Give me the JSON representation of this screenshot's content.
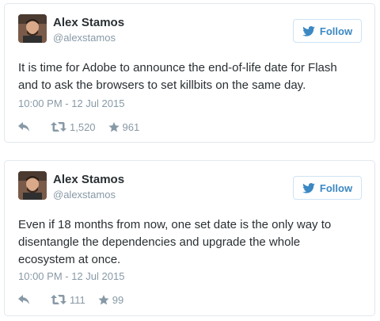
{
  "colors": {
    "follow_blue": "#3b88c3",
    "meta_gray": "#8899a6",
    "text_dark": "#292f33",
    "border": "#e1e8ed"
  },
  "icons": {
    "follow": "twitter-bird-icon",
    "reply": "reply-arrow-icon",
    "retweet": "retweet-icon",
    "favorite": "star-icon"
  },
  "tweets": [
    {
      "name": "Alex Stamos",
      "handle": "@alexstamos",
      "follow_label": "Follow",
      "text": "It is time for Adobe to announce the end-of-life date for Flash\nand to ask the browsers to set killbits on the same day.",
      "timestamp": "10:00 PM - 12 Jul 2015",
      "retweets": "1,520",
      "favorites": "961"
    },
    {
      "name": "Alex Stamos",
      "handle": "@alexstamos",
      "follow_label": "Follow",
      "text": "Even if 18 months from now, one set date is the only way to\ndisentangle the dependencies and upgrade the whole\necosystem at once.",
      "timestamp": "10:00 PM - 12 Jul 2015",
      "retweets": "111",
      "favorites": "99"
    }
  ]
}
